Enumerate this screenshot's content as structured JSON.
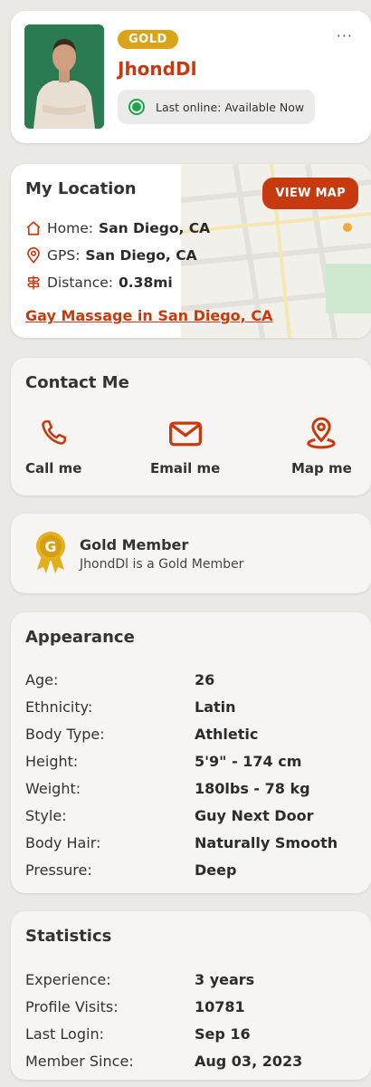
{
  "profile": {
    "badge": "GOLD",
    "username": "JhondDl",
    "online_text": "Last online: Available Now",
    "more_label": "···"
  },
  "location": {
    "title": "My Location",
    "view_map_label": "VIEW MAP",
    "home_label": "Home:",
    "home_value": "San Diego, CA",
    "gps_label": "GPS:",
    "gps_value": "San Diego, CA",
    "distance_label": "Distance:",
    "distance_value": "0.38mi",
    "link_text": "Gay Massage in San Diego, CA"
  },
  "contact": {
    "title": "Contact Me",
    "items": [
      {
        "label": "Call me",
        "icon": "phone-icon"
      },
      {
        "label": "Email me",
        "icon": "envelope-icon"
      },
      {
        "label": "Map me",
        "icon": "map-pin-icon"
      }
    ]
  },
  "gold": {
    "title": "Gold Member",
    "subtitle": "JhondDl is a Gold Member",
    "icon": "gold-medal-icon"
  },
  "appearance": {
    "title": "Appearance",
    "rows": [
      {
        "label": "Age:",
        "value": "26"
      },
      {
        "label": "Ethnicity:",
        "value": "Latin"
      },
      {
        "label": "Body Type:",
        "value": "Athletic"
      },
      {
        "label": "Height:",
        "value": "5'9\" - 174 cm"
      },
      {
        "label": "Weight:",
        "value": "180lbs - 78 kg"
      },
      {
        "label": "Style:",
        "value": "Guy Next Door"
      },
      {
        "label": "Body Hair:",
        "value": "Naturally Smooth"
      },
      {
        "label": "Pressure:",
        "value": "Deep"
      }
    ]
  },
  "statistics": {
    "title": "Statistics",
    "rows": [
      {
        "label": "Experience:",
        "value": "3 years"
      },
      {
        "label": "Profile Visits:",
        "value": "10781"
      },
      {
        "label": "Last Login:",
        "value": "Sep 16"
      },
      {
        "label": "Member Since:",
        "value": "Aug 03, 2023"
      }
    ]
  },
  "colors": {
    "accent": "#c8390e",
    "gold": "#d9a418",
    "online": "#1ea44a"
  }
}
